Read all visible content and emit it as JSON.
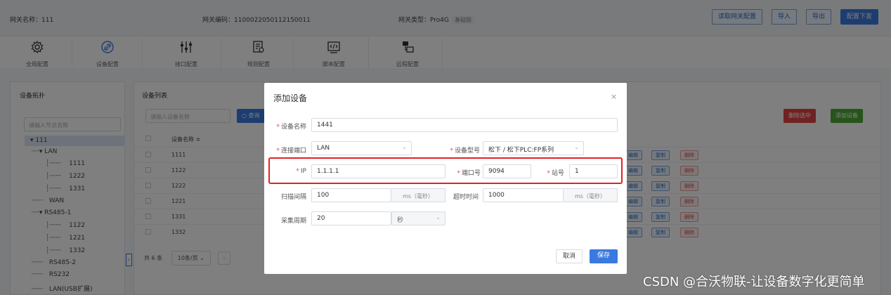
{
  "header": {
    "gateway_name": "网关名称：111",
    "gateway_code": "网关编码：1100022050112150011",
    "gateway_type": "网关类型：Pro4G",
    "gateway_badge": "基础版",
    "btn_read": "读取网关配置",
    "btn_import": "导入",
    "btn_export": "导出",
    "btn_deploy": "配置下发"
  },
  "tabs": [
    {
      "label": "全局配置",
      "icon": "gear-icon"
    },
    {
      "label": "设备配置",
      "icon": "link-icon"
    },
    {
      "label": "接口配置",
      "icon": "sliders-icon"
    },
    {
      "label": "规则配置",
      "icon": "rules-icon"
    },
    {
      "label": "脚本配置",
      "icon": "code-icon"
    },
    {
      "label": "远程配置",
      "icon": "remote-icon"
    }
  ],
  "left": {
    "title": "设备拓扑",
    "search_placeholder": "请输入节点名称",
    "tree": [
      "111",
      "LAN",
      "1111",
      "1222",
      "1331",
      "WAN",
      "RS485-1",
      "1122",
      "1221",
      "1332",
      "RS485-2",
      "RS232",
      "LAN(USB扩展)"
    ]
  },
  "list": {
    "title": "设备列表",
    "search_placeholder": "请输入设备名称",
    "search_btn": "查询",
    "btn_delete_selected": "删除选中",
    "btn_add": "添加设备",
    "col_name": "设备名称",
    "rows": [
      "1111",
      "1122",
      "1222",
      "1221",
      "1331",
      "1332"
    ],
    "act_edit": "编辑",
    "act_copy": "复制",
    "act_delete": "删除",
    "total": "共 6 条",
    "page_size": "10条/页"
  },
  "dialog": {
    "title": "添加设备",
    "close": "×",
    "device_name_label": "设备名称",
    "device_name_value": "1441",
    "port_label": "连接端口",
    "port_value": "LAN",
    "model_label": "设备型号",
    "model_value": "松下 / 松下PLC:FP系列",
    "ip_label": "IP",
    "ip_value": "1.1.1.1",
    "port_no_label": "端口号",
    "port_no_value": "9094",
    "station_label": "站号",
    "station_value": "1",
    "scan_label": "扫描间隔",
    "scan_value": "100",
    "scan_unit": "ms（毫秒）",
    "timeout_label": "超时时间",
    "timeout_value": "1000",
    "timeout_unit": "ms（毫秒）",
    "cycle_label": "采集周期",
    "cycle_value": "20",
    "cycle_unit": "秒",
    "cancel": "取消",
    "save": "保存"
  },
  "watermark": "CSDN @合沃物联-让设备数字化更简单",
  "colors": {
    "primary": "#3a7ae0",
    "danger": "#e04444",
    "success": "#4caa33",
    "highlight": "#e02424"
  }
}
